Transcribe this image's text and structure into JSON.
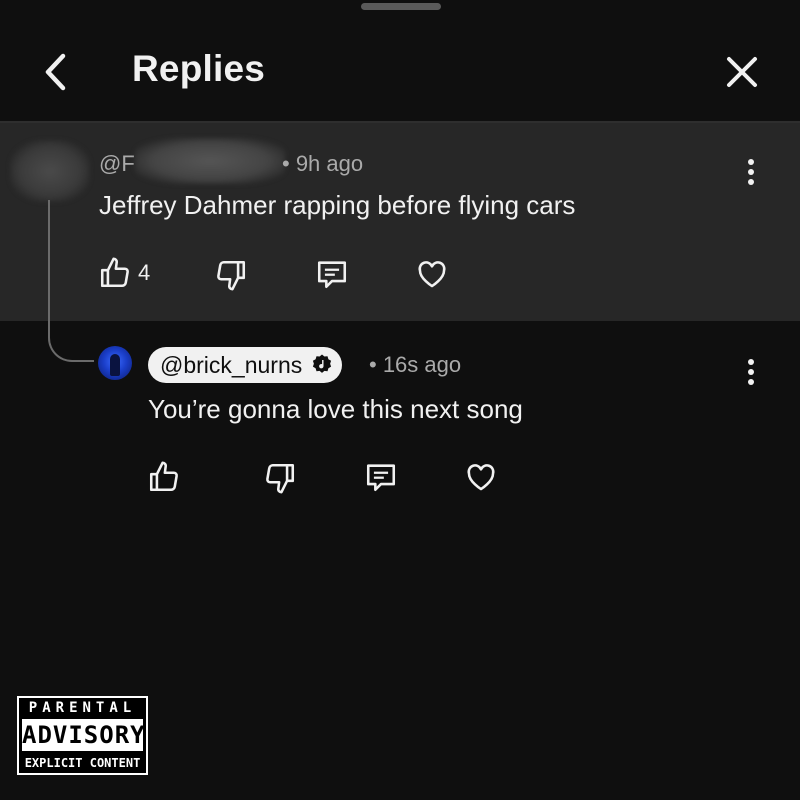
{
  "header": {
    "title": "Replies",
    "back_icon": "chevron-left-icon",
    "close_icon": "close-icon"
  },
  "parent_comment": {
    "author": "@F",
    "timestamp": "• 9h ago",
    "text": "Jeffrey Dahmer rapping before flying cars",
    "like_count": "4"
  },
  "reply": {
    "author": "@brick_nurns",
    "badge_icon": "music-note-badge-icon",
    "timestamp": "• 16s ago",
    "text": "You’re gonna love this next song"
  },
  "parental_advisory": {
    "line1": "PARENTAL",
    "line2": "ADVISORY",
    "line3": "EXPLICIT CONTENT"
  },
  "colors": {
    "background": "#0f0f0f",
    "highlight": "#272727",
    "text": "#f1f1f1",
    "meta": "#aaaaaa"
  }
}
